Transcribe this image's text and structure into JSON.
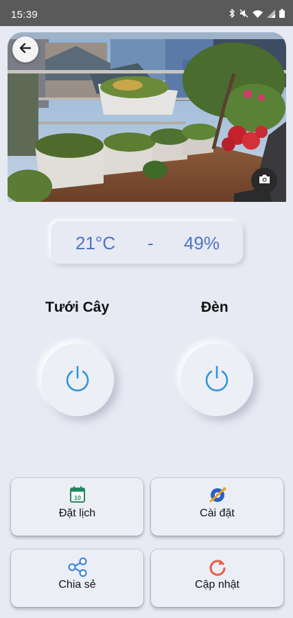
{
  "status_bar": {
    "time": "15:39",
    "icons": [
      "bluetooth-icon",
      "mute-icon",
      "wifi-icon",
      "signal-icon",
      "battery-icon"
    ]
  },
  "photo": {
    "back_icon": "back-arrow-icon",
    "camera_icon": "camera-icon"
  },
  "readings": {
    "temperature": "21°C",
    "separator": "-",
    "humidity": "49%"
  },
  "controls": {
    "watering": {
      "title": "Tưới Cây",
      "icon": "power-icon"
    },
    "light": {
      "title": "Đèn",
      "icon": "power-icon"
    }
  },
  "menu": [
    {
      "label": "Đặt lịch",
      "icon": "calendar-icon"
    },
    {
      "label": "Cài đặt",
      "icon": "settings-icon"
    },
    {
      "label": "Chia sẻ",
      "icon": "share-icon"
    },
    {
      "label": "Cập nhật",
      "icon": "refresh-icon"
    }
  ],
  "colors": {
    "accent": "#4f73c4",
    "power": "#2f95dc",
    "background": "#e7e9f3",
    "status_bar": "#5a5a5a"
  }
}
